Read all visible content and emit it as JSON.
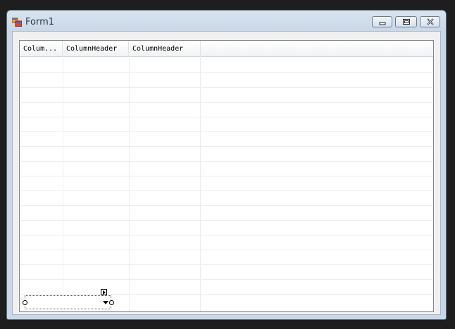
{
  "window": {
    "title": "Form1"
  },
  "listview": {
    "columns": [
      {
        "label": "Colum..."
      },
      {
        "label": "ColumnHeader"
      },
      {
        "label": "ColumnHeader"
      }
    ]
  },
  "icons": {
    "app": "app-form-icon",
    "minimize": "minimize-icon",
    "maximize": "maximize-icon",
    "close": "close-icon",
    "dropdown": "chevron-down-icon",
    "smart_tag": "smart-tag-icon"
  }
}
